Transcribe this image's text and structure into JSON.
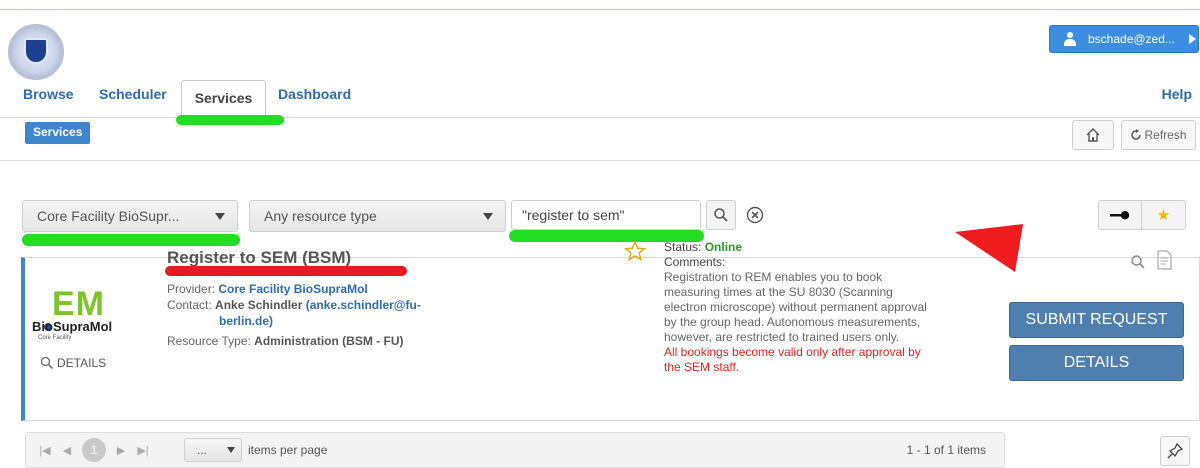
{
  "user": {
    "label": "bschade@zed..."
  },
  "nav": {
    "tabs": [
      "Browse",
      "Scheduler",
      "Services",
      "Dashboard"
    ],
    "active_tab": "Services",
    "help": "Help"
  },
  "breadcrumb": "Services",
  "toolbar": {
    "refresh_label": "Refresh"
  },
  "filters": {
    "provider": "Core Facility BioSupr...",
    "resource_type": "Any resource type",
    "search_value": "\"register to sem\""
  },
  "result": {
    "logo": {
      "main": "EM",
      "sub": "BioSupraMol",
      "tag": "Core Facility"
    },
    "details_link": "DETAILS",
    "title": "Register to SEM (BSM)",
    "provider_label": "Provider:",
    "provider": "Core Facility BioSupraMol",
    "contact_label": "Contact:",
    "contact_name": "Anke Schindler",
    "contact_email_line1": "(anke.schindler@fu-",
    "contact_email_line2": "berlin.de)",
    "resource_type_label": "Resource Type:",
    "resource_type": "Administration (BSM - FU)",
    "status_label": "Status:",
    "status": "Online",
    "comments_label": "Comments:",
    "comments": "Registration to REM enables you to book measuring times at the SU 8030 (Scanning electron microscope) without permanent approval by the group head. Autonomous measurements, however, are restricted to trained users only.",
    "warning": "All bookings become valid only after approval by the SEM staff.",
    "submit_label": "SUBMIT REQUEST",
    "details_label": "DETAILS"
  },
  "pager": {
    "current_page": "1",
    "per_page": "...",
    "per_page_label": "items per page",
    "count": "1 - 1 of 1 items"
  },
  "colors": {
    "accent_blue": "#3e86cc",
    "button_blue": "#4f7fae",
    "highlight_green": "#22dd22",
    "highlight_red": "#e8191f",
    "online_green": "#24a124"
  }
}
